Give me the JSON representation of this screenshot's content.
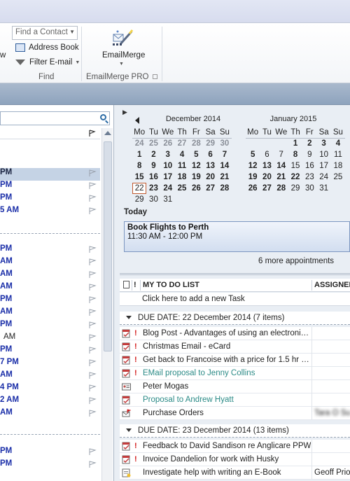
{
  "ribbon": {
    "find_contact_placeholder": "Find a Contact",
    "address_book": "Address Book",
    "filter_email": "Filter E-mail",
    "find_group": "Find",
    "emailmerge_button": "EmailMerge",
    "emailmerge_group": "EmailMerge PRO",
    "left_partial": "w"
  },
  "message_list": {
    "rows": [
      {
        "time": "PM",
        "style": "sel"
      },
      {
        "time": "PM",
        "style": "unread"
      },
      {
        "time": "PM",
        "style": "unread"
      },
      {
        "time": "5 AM",
        "style": "unread"
      },
      {
        "time": "PM",
        "style": "unread"
      },
      {
        "time": "AM",
        "style": "unread"
      },
      {
        "time": "AM",
        "style": "unread"
      },
      {
        "time": "AM",
        "style": "unread"
      },
      {
        "time": "PM",
        "style": "unread"
      },
      {
        "time": "AM",
        "style": "unread"
      },
      {
        "time": "PM",
        "style": "unread"
      },
      {
        "time": "AM",
        "style": "plain"
      },
      {
        "time": "PM",
        "style": "unread"
      },
      {
        "time": "7 PM",
        "style": "unread"
      },
      {
        "time": "AM",
        "style": "unread"
      },
      {
        "time": "4 PM",
        "style": "unread"
      },
      {
        "time": "2 AM",
        "style": "unread"
      },
      {
        "time": "AM",
        "style": "unread"
      },
      {
        "time": "PM",
        "style": "unread"
      },
      {
        "time": "PM",
        "style": "unread"
      }
    ]
  },
  "calendar": {
    "weekdays": [
      "Mo",
      "Tu",
      "We",
      "Th",
      "Fr",
      "Sa",
      "Su"
    ],
    "months": [
      {
        "title": "December 2014",
        "days": [
          {
            "d": "24",
            "t": "o"
          },
          {
            "d": "25",
            "t": "o"
          },
          {
            "d": "26",
            "t": "o"
          },
          {
            "d": "27",
            "t": "o"
          },
          {
            "d": "28",
            "t": "o"
          },
          {
            "d": "29",
            "t": "o"
          },
          {
            "d": "30",
            "t": "o"
          },
          {
            "d": "1",
            "t": "b"
          },
          {
            "d": "2",
            "t": "b"
          },
          {
            "d": "3",
            "t": "b"
          },
          {
            "d": "4",
            "t": "b"
          },
          {
            "d": "5",
            "t": "b"
          },
          {
            "d": "6",
            "t": "b"
          },
          {
            "d": "7",
            "t": "b"
          },
          {
            "d": "8",
            "t": "b"
          },
          {
            "d": "9",
            "t": "b"
          },
          {
            "d": "10",
            "t": "b"
          },
          {
            "d": "11",
            "t": "b"
          },
          {
            "d": "12",
            "t": "b"
          },
          {
            "d": "13",
            "t": "b"
          },
          {
            "d": "14",
            "t": "b"
          },
          {
            "d": "15",
            "t": "b"
          },
          {
            "d": "16",
            "t": "b"
          },
          {
            "d": "17",
            "t": "b"
          },
          {
            "d": "18",
            "t": "b"
          },
          {
            "d": "19",
            "t": "b"
          },
          {
            "d": "20",
            "t": "b"
          },
          {
            "d": "21",
            "t": "b"
          },
          {
            "d": "22",
            "t": "today"
          },
          {
            "d": "23",
            "t": "b"
          },
          {
            "d": "24",
            "t": "b"
          },
          {
            "d": "25",
            "t": "b"
          },
          {
            "d": "26",
            "t": "b"
          },
          {
            "d": "27",
            "t": "b"
          },
          {
            "d": "28",
            "t": "b"
          },
          {
            "d": "29",
            "t": "n"
          },
          {
            "d": "30",
            "t": "n"
          },
          {
            "d": "31",
            "t": "n"
          },
          {
            "d": "",
            "t": "n"
          },
          {
            "d": "",
            "t": "n"
          },
          {
            "d": "",
            "t": "n"
          },
          {
            "d": "",
            "t": "n"
          }
        ]
      },
      {
        "title": "January 2015",
        "days": [
          {
            "d": "",
            "t": "n"
          },
          {
            "d": "",
            "t": "n"
          },
          {
            "d": "",
            "t": "n"
          },
          {
            "d": "1",
            "t": "b"
          },
          {
            "d": "2",
            "t": "b"
          },
          {
            "d": "3",
            "t": "b"
          },
          {
            "d": "4",
            "t": "b"
          },
          {
            "d": "5",
            "t": "b"
          },
          {
            "d": "6",
            "t": "n"
          },
          {
            "d": "7",
            "t": "n"
          },
          {
            "d": "8",
            "t": "b"
          },
          {
            "d": "9",
            "t": "n"
          },
          {
            "d": "10",
            "t": "n"
          },
          {
            "d": "11",
            "t": "n"
          },
          {
            "d": "12",
            "t": "b"
          },
          {
            "d": "13",
            "t": "b"
          },
          {
            "d": "14",
            "t": "b"
          },
          {
            "d": "15",
            "t": "n"
          },
          {
            "d": "16",
            "t": "n"
          },
          {
            "d": "17",
            "t": "n"
          },
          {
            "d": "18",
            "t": "n"
          },
          {
            "d": "19",
            "t": "b"
          },
          {
            "d": "20",
            "t": "b"
          },
          {
            "d": "21",
            "t": "b"
          },
          {
            "d": "22",
            "t": "b"
          },
          {
            "d": "23",
            "t": "n"
          },
          {
            "d": "24",
            "t": "n"
          },
          {
            "d": "25",
            "t": "n"
          },
          {
            "d": "26",
            "t": "b"
          },
          {
            "d": "27",
            "t": "b"
          },
          {
            "d": "28",
            "t": "b"
          },
          {
            "d": "29",
            "t": "n"
          },
          {
            "d": "30",
            "t": "n"
          },
          {
            "d": "31",
            "t": "n"
          },
          {
            "d": "",
            "t": "n"
          },
          {
            "d": "",
            "t": "n"
          },
          {
            "d": "",
            "t": "n"
          },
          {
            "d": "",
            "t": "n"
          },
          {
            "d": "",
            "t": "n"
          },
          {
            "d": "",
            "t": "n"
          },
          {
            "d": "",
            "t": "n"
          },
          {
            "d": "",
            "t": "n"
          }
        ]
      }
    ]
  },
  "agenda": {
    "today_label": "Today",
    "appointment_title": "Book Flights to Perth",
    "appointment_time": "11:30 AM - 12:00 PM",
    "more_appointments": "6 more appointments"
  },
  "todo": {
    "header_title": "MY TO DO LIST",
    "header_assigned": "ASSIGNED",
    "add_task": "Click here to add a new Task",
    "groups": [
      {
        "label": "DUE DATE: 22 December 2014 (7 items)",
        "items": [
          {
            "icon": "task-icon",
            "important": true,
            "subject": "Blog Post - Advantages of using an electroni…",
            "teal": false,
            "assigned": ""
          },
          {
            "icon": "task-icon",
            "important": true,
            "subject": "Christmas Email - eCard",
            "teal": false,
            "assigned": ""
          },
          {
            "icon": "task-icon",
            "important": true,
            "subject": "Get back to Francoise with a price for 1.5 hr …",
            "teal": false,
            "assigned": ""
          },
          {
            "icon": "task-icon",
            "important": true,
            "subject": "EMail proposal to Jenny Collins",
            "teal": true,
            "assigned": ""
          },
          {
            "icon": "contact-card-icon",
            "important": false,
            "subject": "Peter Mogas",
            "teal": false,
            "assigned": ""
          },
          {
            "icon": "task-icon",
            "important": false,
            "subject": "Proposal to Andrew Hyatt",
            "teal": true,
            "assigned": ""
          },
          {
            "icon": "flagged-mail-icon",
            "important": false,
            "subject": "Purchase Orders",
            "teal": false,
            "assigned": "Tara O Sul"
          }
        ]
      },
      {
        "label": "DUE DATE: 23 December 2014 (13 items)",
        "items": [
          {
            "icon": "task-icon",
            "important": true,
            "subject": "Feedback to David Sandison re Anglicare PPW",
            "teal": false,
            "assigned": ""
          },
          {
            "icon": "task-icon",
            "important": true,
            "subject": "Invoice Dandelion for work with Husky",
            "teal": false,
            "assigned": ""
          },
          {
            "icon": "note-icon",
            "important": false,
            "subject": "Investigate help with writing an E-Book",
            "teal": false,
            "assigned": "Geoff Prior"
          }
        ]
      }
    ]
  },
  "colors": {
    "unread_blue": "#1a2ea8",
    "teal_subject": "#2a8a86",
    "importance_red": "#d21b1b",
    "today_outline": "#c0592f"
  }
}
